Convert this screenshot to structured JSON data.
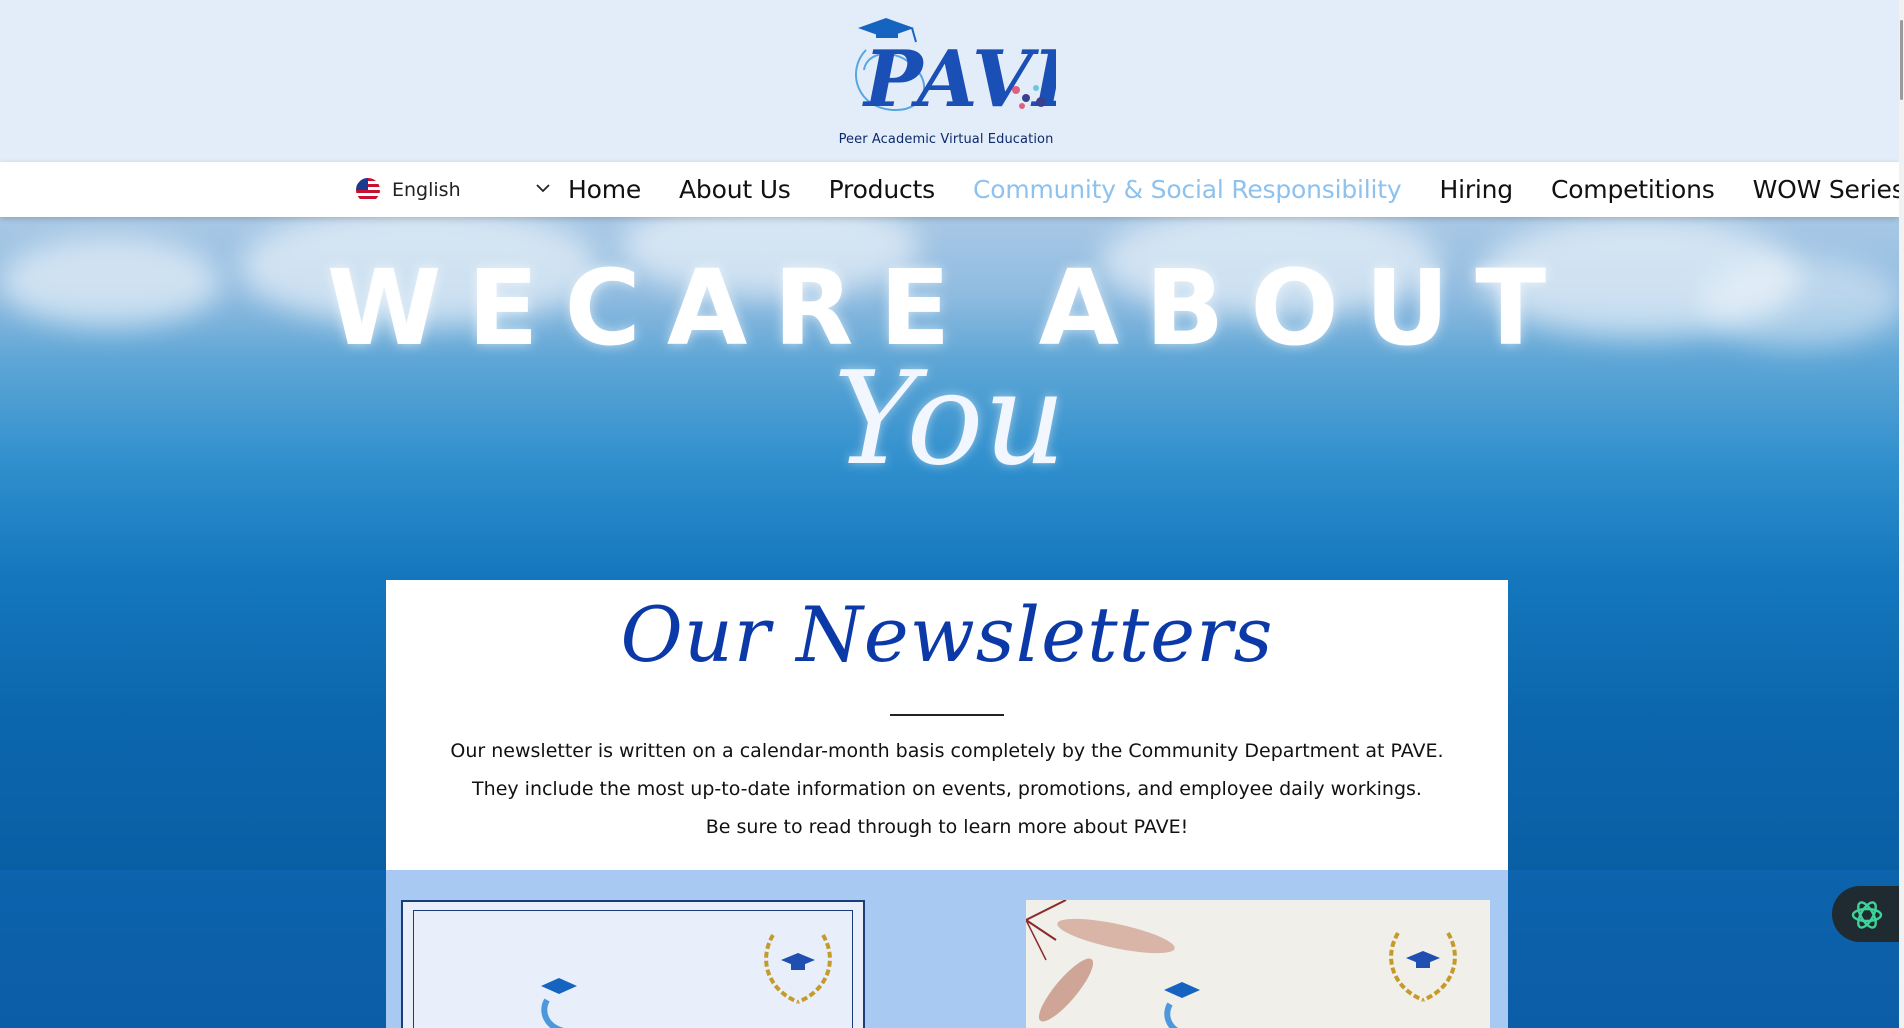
{
  "brand": {
    "logo_text": "PAVE",
    "subtitle": "Peer Academic Virtual Education"
  },
  "language": {
    "selected": "English",
    "flag_icon": "us-flag-icon"
  },
  "nav": {
    "items": [
      {
        "label": "Home",
        "active": false
      },
      {
        "label": "About Us",
        "active": false
      },
      {
        "label": "Products",
        "active": false
      },
      {
        "label": "Community & Social Responsibility",
        "active": true
      },
      {
        "label": "Hiring",
        "active": false
      },
      {
        "label": "Competitions",
        "active": false
      },
      {
        "label": "WOW Series",
        "active": false
      }
    ],
    "active_color": "#8ec2ee"
  },
  "hero": {
    "title": "WECARE ABOUT",
    "script": "You"
  },
  "newsletters": {
    "heading": "Our Newsletters",
    "lines": [
      "Our newsletter is written on a calendar-month basis completely by the Community Department at PAVE.",
      "They include the most up-to-date information on events, promotions, and employee daily workings.",
      "Be sure to read through to learn more about PAVE!"
    ]
  },
  "colors": {
    "banner_bg": "#e3edf9",
    "heading_blue": "#0b3aa8",
    "panel_bg": "#a8c9f1",
    "ocean_dark": "#0b5da6"
  },
  "chat_widget": {
    "icon": "chatgpt-icon"
  }
}
